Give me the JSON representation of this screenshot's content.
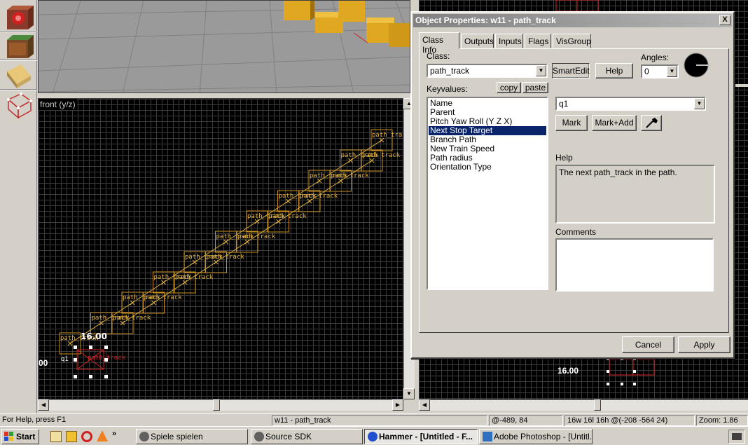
{
  "viewports": {
    "front_label": "front (y/z)",
    "entity_label": "path_track",
    "selected_label": "q1",
    "size_left": "16.00",
    "size_left_edge": "00",
    "size_right": "16.00"
  },
  "dialog": {
    "title": "Object Properties: w11 - path_track",
    "close_glyph": "X",
    "tabs": [
      "Class Info",
      "Outputs",
      "Inputs",
      "Flags",
      "VisGroup"
    ],
    "class_label": "Class:",
    "class_value": "path_track",
    "smartedit_label": "SmartEdit",
    "help_button": "Help",
    "angles_label": "Angles:",
    "angles_value": "0",
    "keyvalues_label": "Keyvalues:",
    "copy_button": "copy",
    "paste_button": "paste",
    "keyvalues": [
      "Name",
      "Parent",
      "Pitch Yaw Roll (Y Z X)",
      "Next Stop Target",
      "Branch Path",
      "New Train Speed",
      "Path radius",
      "Orientation Type"
    ],
    "selected_keyvalue": "Next Stop Target",
    "value_field": "q1",
    "mark_button": "Mark",
    "markadd_button": "Mark+Add",
    "help_label": "Help",
    "help_text": "The next path_track in the path.",
    "comments_label": "Comments",
    "comments_text": "",
    "cancel_button": "Cancel",
    "apply_button": "Apply"
  },
  "statusbar": {
    "help": "For Help, press F1",
    "selection": "w11 - path_track",
    "coords": "@-489, 84",
    "size": "16w 16l 16h @(-208 -564 24)",
    "zoom": "Zoom: 1.86"
  },
  "taskbar": {
    "start": "Start",
    "tasks": [
      "Spiele spielen",
      "Source SDK",
      "Hammer - [Untitled - F...",
      "Adobe Photoshop - [Untitl..."
    ],
    "chevron": "»"
  }
}
